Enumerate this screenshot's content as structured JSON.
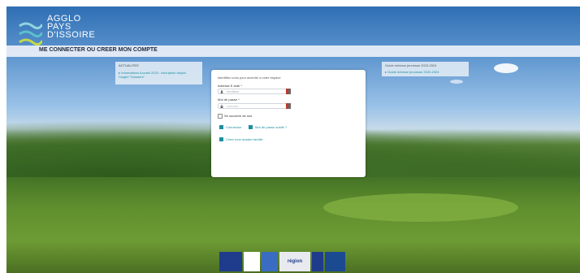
{
  "brand": {
    "line1": "AGGLO",
    "line2": "PAYS",
    "line3": "D'ISSOIRE"
  },
  "header": {
    "title": "ME CONNECTER OU CREER MON COMPTE"
  },
  "news": {
    "title": "ACTUALITES",
    "link1": "Informations Accueil 2023 : inscription depuis",
    "link2": "l'onglet \"Dossiers\""
  },
  "guide": {
    "title": "Guide enfance jeunesse 2023-2024",
    "link": "Guide enfance jeunesse 2023-2024"
  },
  "login": {
    "intro": "Identifiez-vous pour accéder à votre espace",
    "email_label": "Adresse E-mail *",
    "email_placeholder": "Identifiant",
    "password_label": "Mot de passe *",
    "password_placeholder": "••••••••••••",
    "remember_label": "Se souvenir de moi",
    "connect_label": "Connexion",
    "forgot_label": "Mot de passe oublié ?",
    "create_label": "Créer mon dossier famille"
  },
  "footer": {
    "region": "région"
  }
}
